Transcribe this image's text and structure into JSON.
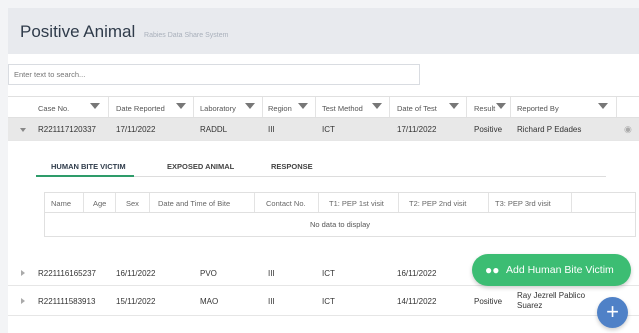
{
  "header": {
    "title": "Positive Animal",
    "subtitle": "Rabies Data Share System"
  },
  "search": {
    "placeholder": "Enter text to search..."
  },
  "columns": [
    "Case No.",
    "Date Reported",
    "Laboratory",
    "Region",
    "Test Method",
    "Date of Test",
    "Result",
    "Reported By"
  ],
  "rows": [
    {
      "case_no": "R221117120337",
      "date_reported": "17/11/2022",
      "laboratory": "RADDL",
      "region": "III",
      "test_method": "ICT",
      "date_of_test": "17/11/2022",
      "result": "Positive",
      "reported_by": "Richard P Edades"
    },
    {
      "case_no": "R221116165237",
      "date_reported": "16/11/2022",
      "laboratory": "PVO",
      "region": "III",
      "test_method": "ICT",
      "date_of_test": "16/11/2022",
      "result": "",
      "reported_by": ""
    },
    {
      "case_no": "R221111583913",
      "date_reported": "15/11/2022",
      "laboratory": "MAO",
      "region": "III",
      "test_method": "ICT",
      "date_of_test": "14/11/2022",
      "result": "Positive",
      "reported_by": "Ray Jezrell Pablico Suarez"
    }
  ],
  "detail": {
    "tabs": [
      "HUMAN BITE VICTIM",
      "EXPOSED ANIMAL",
      "RESPONSE"
    ],
    "active_tab": "HUMAN BITE VICTIM",
    "columns": [
      "Name",
      "Age",
      "Sex",
      "Date and Time of Bite",
      "Contact No.",
      "T1: PEP 1st visit",
      "T2: PEP 2nd visit",
      "T3: PEP 3rd visit"
    ],
    "empty_text": "No data to display"
  },
  "actions": {
    "add_victim": "Add Human Bite Victim",
    "plus": "+"
  },
  "colors": {
    "accent_green": "#3cbd73",
    "accent_blue": "#4f81c7",
    "tab_green": "#2e9c6a"
  },
  "icons": {
    "expand": "chevron-down-icon",
    "collapse": "chevron-right-icon",
    "view": "eye-icon",
    "filter": "filter-icon",
    "victim": "people-icon"
  }
}
